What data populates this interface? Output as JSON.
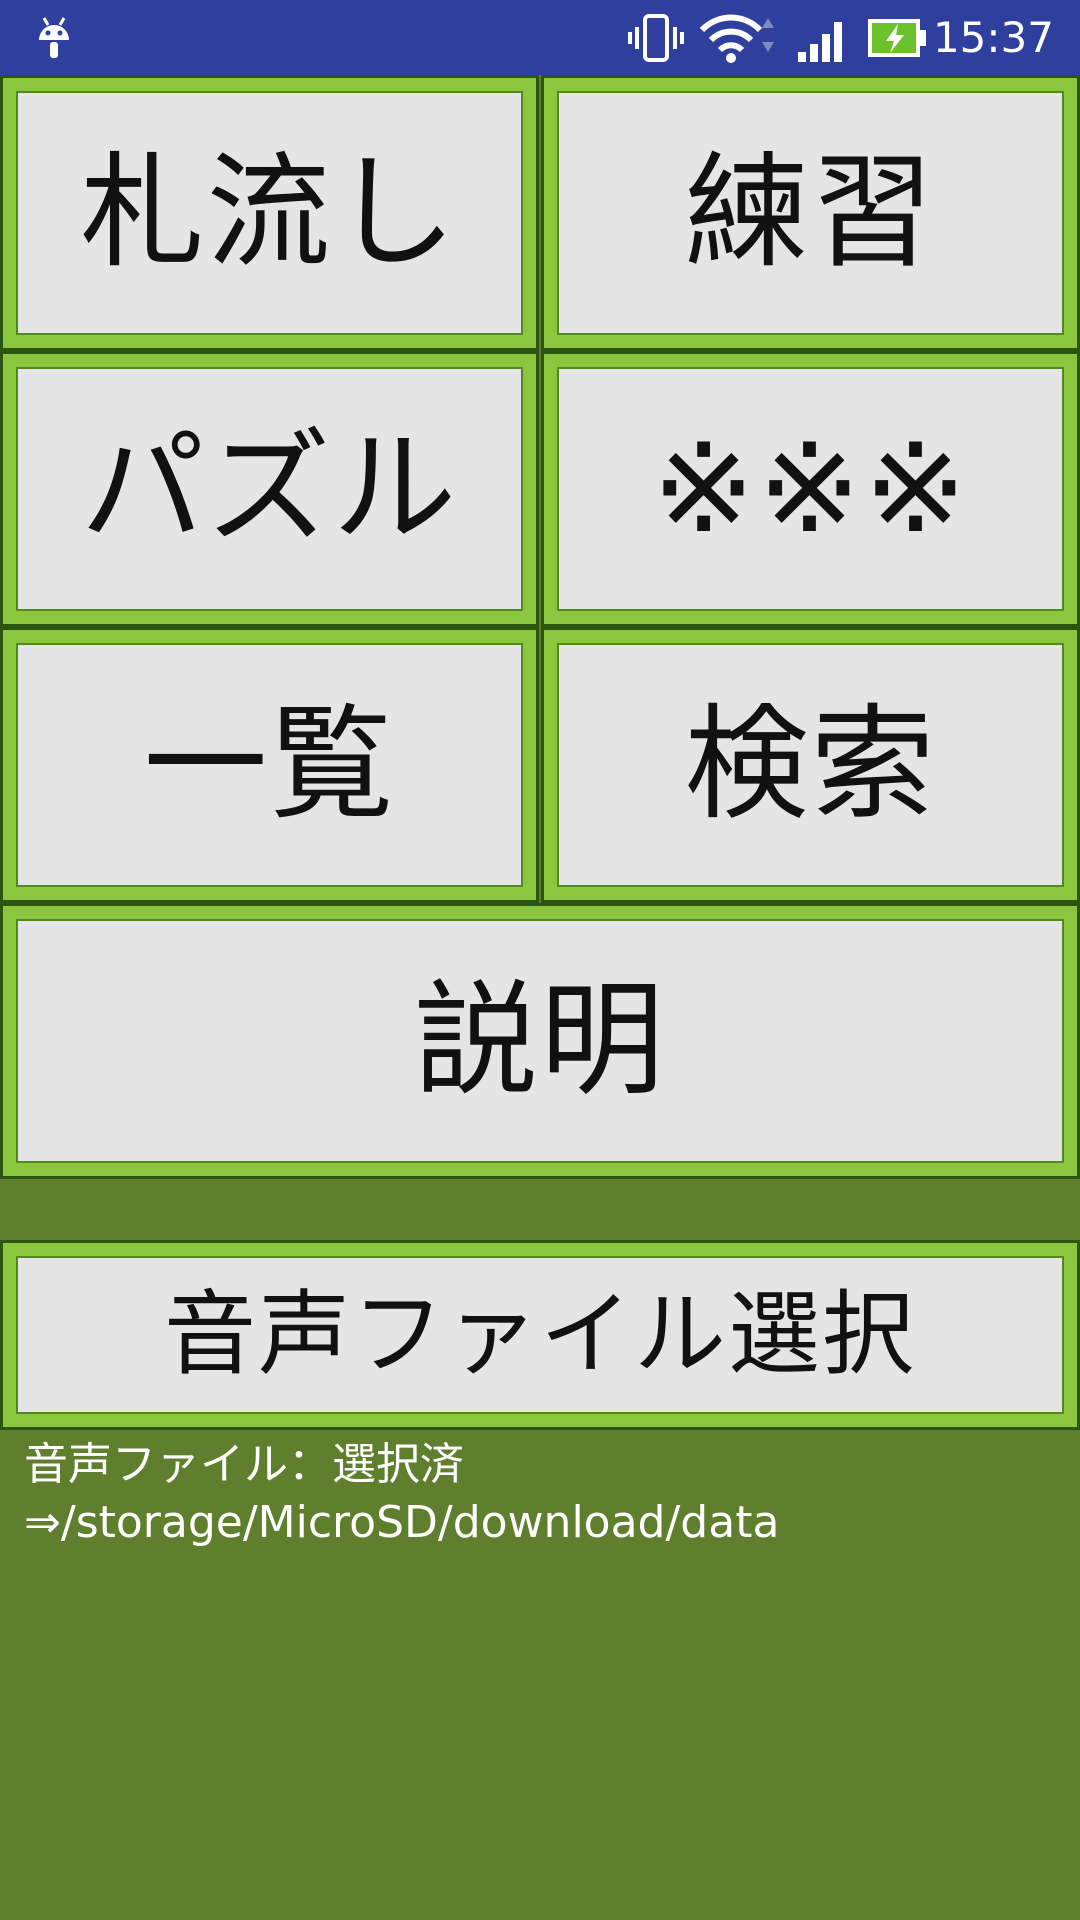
{
  "status_bar": {
    "time": "15:37",
    "icons": [
      "android-icon",
      "vibrate-icon",
      "wifi-icon",
      "signal-icon",
      "battery-charging-icon"
    ]
  },
  "menu": {
    "fudanagashi": "札流し",
    "renshu": "練習",
    "puzzle": "パズル",
    "kome": "※※※",
    "ichiran": "一覧",
    "kensaku": "検索",
    "setsumei": "説明",
    "audio_select": "音声ファイル選択"
  },
  "audio_status": {
    "line1": "音声ファイル：選択済",
    "line2": "⇒/storage/MicroSD/download/data"
  },
  "colors": {
    "status_bar": "#2f3f9e",
    "background": "#5f7f2e",
    "button_border": "#8cc63e",
    "button_face": "#e5e5e5"
  }
}
